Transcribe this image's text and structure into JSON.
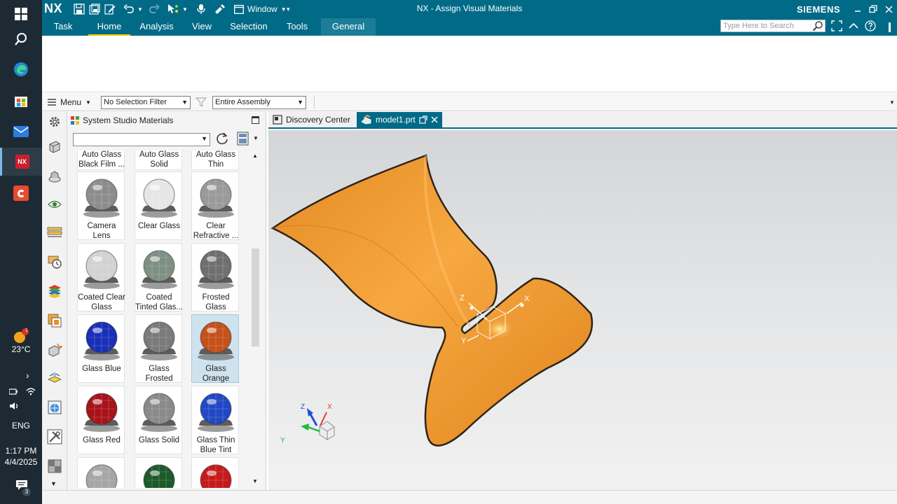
{
  "taskbar": {
    "weather_temp": "23°C",
    "language": "ENG",
    "time": "1:17 PM",
    "date": "4/4/2025",
    "weather_badge": "1",
    "notification_count": "3",
    "apps": [
      "windows-start",
      "search",
      "edge",
      "microsoft-store",
      "mail",
      "nx",
      "camtasia"
    ]
  },
  "titlebar": {
    "logo": "NX",
    "window_menu_label": "Window",
    "title": "NX - Assign Visual Materials",
    "brand": "SIEMENS"
  },
  "ribbon": {
    "tabs": [
      {
        "label": "Task"
      },
      {
        "label": "Home"
      },
      {
        "label": "Analysis"
      },
      {
        "label": "View"
      },
      {
        "label": "Selection"
      },
      {
        "label": "Tools"
      },
      {
        "label": "General"
      }
    ],
    "active_tab": "Home",
    "search_placeholder": "Type Here to Search"
  },
  "selection_bar": {
    "menu_label": "Menu",
    "selection_filter": "No Selection Filter",
    "scope": "Entire Assembly"
  },
  "panel": {
    "title": "System Studio Materials",
    "materials": [
      {
        "label": "Auto Glass Black Film ...",
        "tint": "#bdbdbd"
      },
      {
        "label": "Auto Glass Solid",
        "tint": "#bdbdbd"
      },
      {
        "label": "Auto Glass Thin",
        "tint": "#bdbdbd"
      },
      {
        "label": "Camera Lens",
        "tint": "#8c8c8c"
      },
      {
        "label": "Clear Glass",
        "tint": "#e6e6e6"
      },
      {
        "label": "Clear Refractive ...",
        "tint": "#9a9a9a"
      },
      {
        "label": "Coated Clear Glass",
        "tint": "#d2d2d2"
      },
      {
        "label": "Coated Tinted Glas...",
        "tint": "#7f8f82"
      },
      {
        "label": "Frosted Glass",
        "tint": "#6f6f6f"
      },
      {
        "label": "Glass Blue",
        "tint": "#1a2fb8"
      },
      {
        "label": "Glass Frosted",
        "tint": "#7a7a7a"
      },
      {
        "label": "Glass Orange",
        "tint": "#c5501a"
      },
      {
        "label": "Glass Red",
        "tint": "#a8121a"
      },
      {
        "label": "Glass Solid",
        "tint": "#8a8a8a"
      },
      {
        "label": "Glass Thin Blue Tint",
        "tint": "#2147c4"
      },
      {
        "label": "",
        "tint": "#a6a6a6"
      },
      {
        "label": "",
        "tint": "#1d5a2a"
      },
      {
        "label": "",
        "tint": "#c41a1a"
      }
    ],
    "selected_material": "Glass Orange"
  },
  "document_tabs": [
    {
      "label": "Discovery Center"
    },
    {
      "label": "model1.prt"
    }
  ],
  "viewport": {
    "model_color": "#f5a23a",
    "triad_labels": {
      "z": "Z",
      "y": "Y",
      "x": "X"
    }
  }
}
